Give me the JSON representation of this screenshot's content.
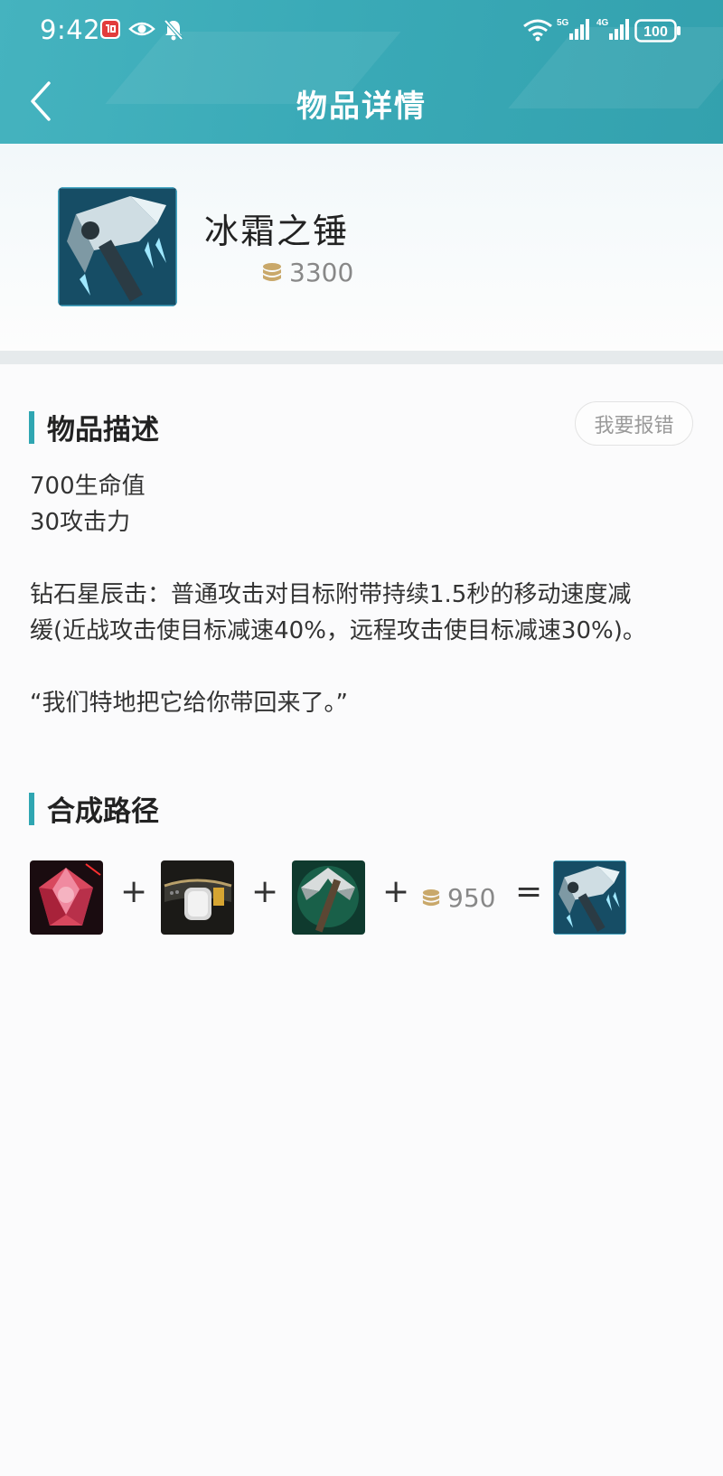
{
  "status_bar": {
    "time": "9:42",
    "left_icons": [
      "app-badge-icon",
      "eye-icon",
      "bell-off-icon"
    ],
    "right_icons": [
      "wifi-icon",
      "signal-5g-icon",
      "signal-4g-icon"
    ],
    "network_5g": "5G",
    "network_4g": "4G",
    "battery": "100"
  },
  "nav": {
    "title": "物品详情",
    "back_icon": "chevron-left-icon"
  },
  "item": {
    "name": "冰霜之锤",
    "price": "3300",
    "icon": "frozen-mallet-icon",
    "coin_icon": "coin-stack-icon"
  },
  "description": {
    "title": "物品描述",
    "report_button": "我要报错",
    "stat_1": "700生命值",
    "stat_2": "30攻击力",
    "passive_line_1": "钻石星辰击：普通攻击对目标附带持续1.5秒的移动速度减",
    "passive_line_2": "缓(近战攻击使目标减速40%，远程攻击使目标减速30%)。",
    "quote": "“我们特地把它给你带回来了。”"
  },
  "recipe": {
    "title": "合成路径",
    "components": [
      {
        "icon": "ruby-crystal-icon"
      },
      {
        "icon": "giants-belt-icon"
      },
      {
        "icon": "jaurim-fist-icon"
      }
    ],
    "plus": "+",
    "equals": "=",
    "extra_cost": "950",
    "result_icon": "frozen-mallet-icon"
  },
  "colors": {
    "header": "#3aaab7",
    "accent": "#2fa6b2",
    "gold": "#c9a86a"
  }
}
